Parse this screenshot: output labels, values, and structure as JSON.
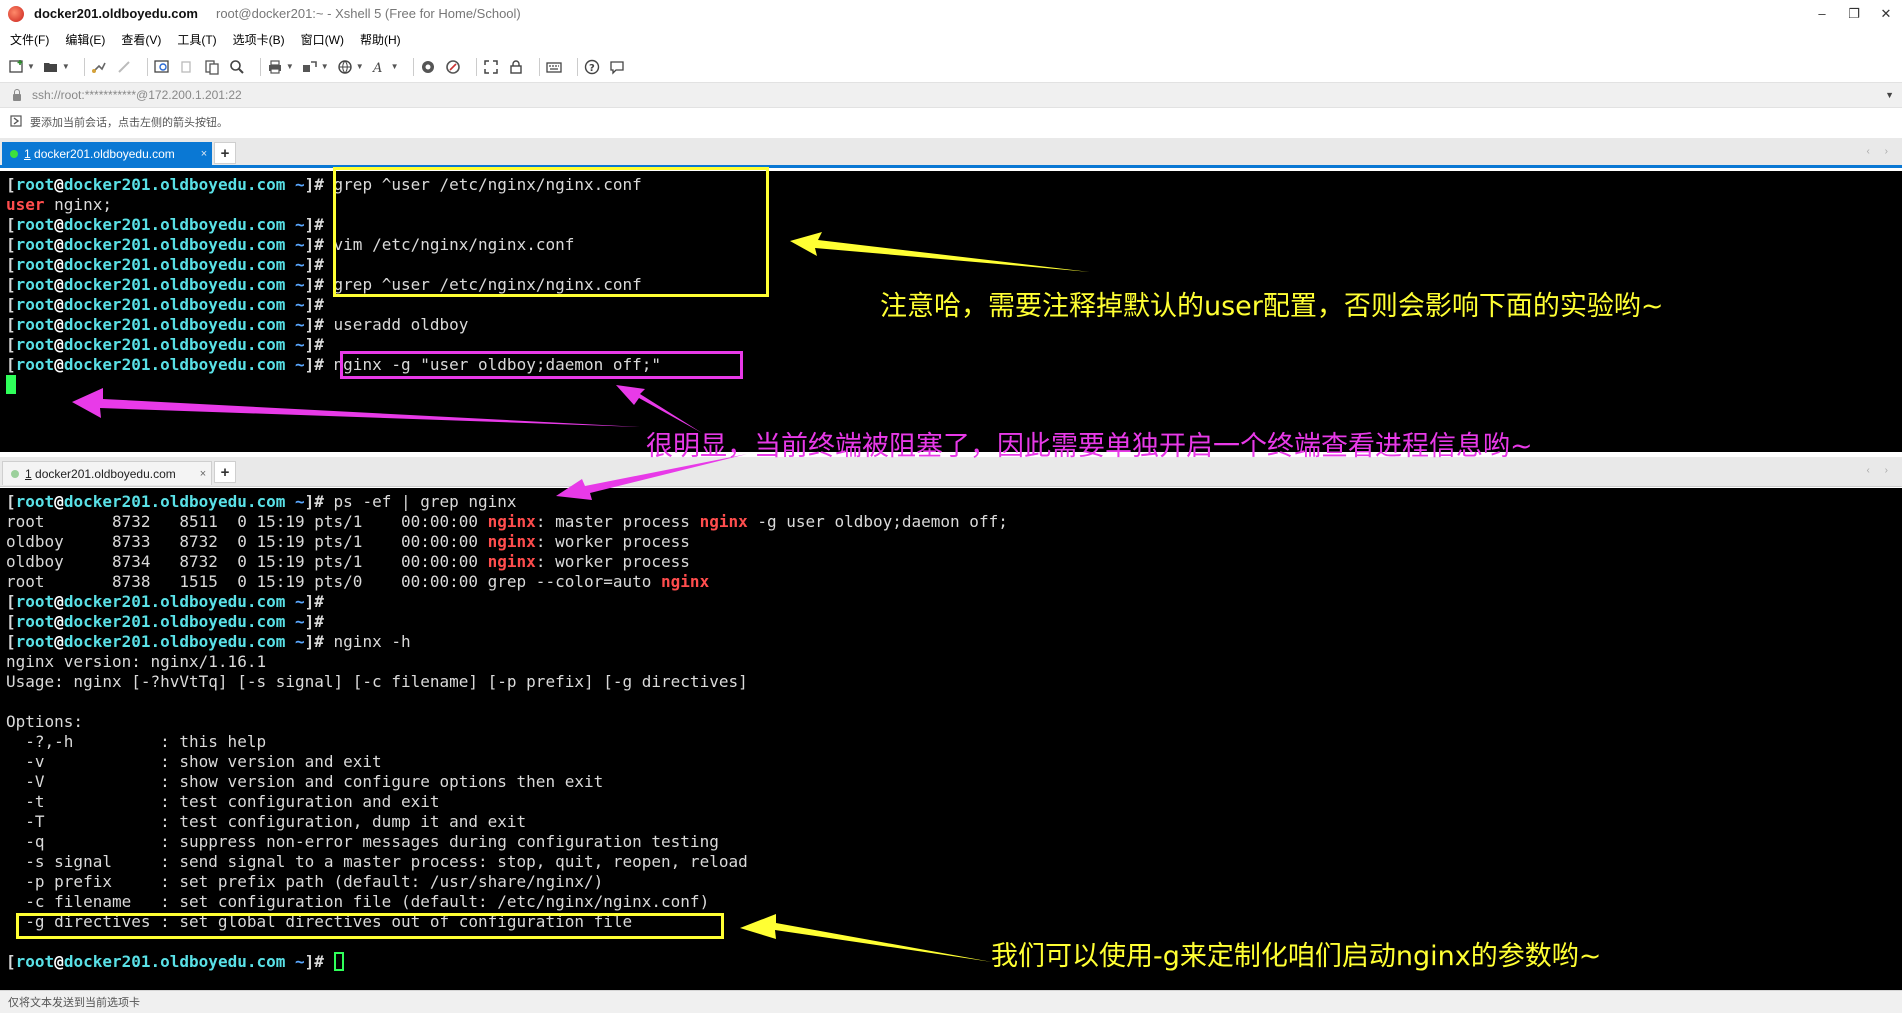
{
  "window": {
    "title": "docker201.oldboyedu.com",
    "subtitle": "root@docker201:~ - Xshell 5 (Free for Home/School)",
    "minimize": "–",
    "maximize": "❐",
    "close": "✕"
  },
  "menu": [
    "文件(F)",
    "编辑(E)",
    "查看(V)",
    "工具(T)",
    "选项卡(B)",
    "窗口(W)",
    "帮助(H)"
  ],
  "address": "ssh://root:***********@172.200.1.201:22",
  "hint": "要添加当前会话，点击左侧的箭头按钮。",
  "tabs": {
    "top": {
      "number": "1",
      "label": " docker201.oldboyedu.com",
      "close": "×"
    },
    "bottom": {
      "number": "1",
      "label": " docker201.oldboyedu.com",
      "close": "×"
    },
    "add": "+",
    "nav": "‹ ›"
  },
  "prompt": {
    "open": "[",
    "user": "root",
    "at": "@",
    "host": "docker201.oldboyedu.com",
    "dir": " ~",
    "close": "]#"
  },
  "terminal_top": [
    {
      "type": "prompt",
      "cmd": " grep ^user /etc/nginx/nginx.conf"
    },
    {
      "type": "output",
      "hl": "user",
      "rest": " nginx;"
    },
    {
      "type": "prompt",
      "cmd": ""
    },
    {
      "type": "prompt",
      "cmd": " vim /etc/nginx/nginx.conf"
    },
    {
      "type": "prompt",
      "cmd": ""
    },
    {
      "type": "prompt",
      "cmd": " grep ^user /etc/nginx/nginx.conf"
    },
    {
      "type": "prompt",
      "cmd": ""
    },
    {
      "type": "prompt",
      "cmd": " useradd oldboy"
    },
    {
      "type": "prompt",
      "cmd": ""
    },
    {
      "type": "prompt",
      "cmd": " nginx -g \"user oldboy;daemon off;\""
    },
    {
      "type": "cursor"
    }
  ],
  "terminal_bottom": [
    {
      "type": "prompt",
      "cmd": " ps -ef | grep nginx"
    },
    {
      "type": "ps",
      "pre": "root       8732   8511  0 15:19 pts/1    00:00:00 ",
      "hl1": "nginx",
      "mid": ": master process ",
      "hl2": "nginx",
      "post": " -g user oldboy;daemon off;"
    },
    {
      "type": "ps",
      "pre": "oldboy     8733   8732  0 15:19 pts/1    00:00:00 ",
      "hl1": "nginx",
      "mid": ": worker process",
      "hl2": "",
      "post": ""
    },
    {
      "type": "ps",
      "pre": "oldboy     8734   8732  0 15:19 pts/1    00:00:00 ",
      "hl1": "nginx",
      "mid": ": worker process",
      "hl2": "",
      "post": ""
    },
    {
      "type": "ps",
      "pre": "root       8738   1515  0 15:19 pts/0    00:00:00 grep --color=auto ",
      "hl1": "nginx",
      "mid": "",
      "hl2": "",
      "post": ""
    },
    {
      "type": "prompt",
      "cmd": ""
    },
    {
      "type": "prompt",
      "cmd": ""
    },
    {
      "type": "prompt",
      "cmd": " nginx -h"
    },
    {
      "type": "text",
      "text": "nginx version: nginx/1.16.1"
    },
    {
      "type": "text",
      "text": "Usage: nginx [-?hvVtTq] [-s signal] [-c filename] [-p prefix] [-g directives]"
    },
    {
      "type": "text",
      "text": ""
    },
    {
      "type": "text",
      "text": "Options:"
    },
    {
      "type": "text",
      "text": "  -?,-h         : this help"
    },
    {
      "type": "text",
      "text": "  -v            : show version and exit"
    },
    {
      "type": "text",
      "text": "  -V            : show version and configure options then exit"
    },
    {
      "type": "text",
      "text": "  -t            : test configuration and exit"
    },
    {
      "type": "text",
      "text": "  -T            : test configuration, dump it and exit"
    },
    {
      "type": "text",
      "text": "  -q            : suppress non-error messages during configuration testing"
    },
    {
      "type": "text",
      "text": "  -s signal     : send signal to a master process: stop, quit, reopen, reload"
    },
    {
      "type": "text",
      "text": "  -p prefix     : set prefix path (default: /usr/share/nginx/)"
    },
    {
      "type": "text",
      "text": "  -c filename   : set configuration file (default: /etc/nginx/nginx.conf)"
    },
    {
      "type": "text",
      "text": "  -g directives : set global directives out of configuration file"
    },
    {
      "type": "text",
      "text": ""
    },
    {
      "type": "prompt",
      "cmd": " ",
      "cursor": true
    }
  ],
  "annotations": {
    "note1": "注意哈，需要注释掉默认的user配置，否则会影响下面的实验哟~",
    "note2": "很明显，当前终端被阻塞了，因此需要单独开启一个终端查看进程信息哟~",
    "note3": "我们可以使用-g来定制化咱们启动nginx的参数哟~",
    "yellow": "#ffff33",
    "magenta": "#e83ae8"
  },
  "status": "仅将文本发送到当前选项卡"
}
